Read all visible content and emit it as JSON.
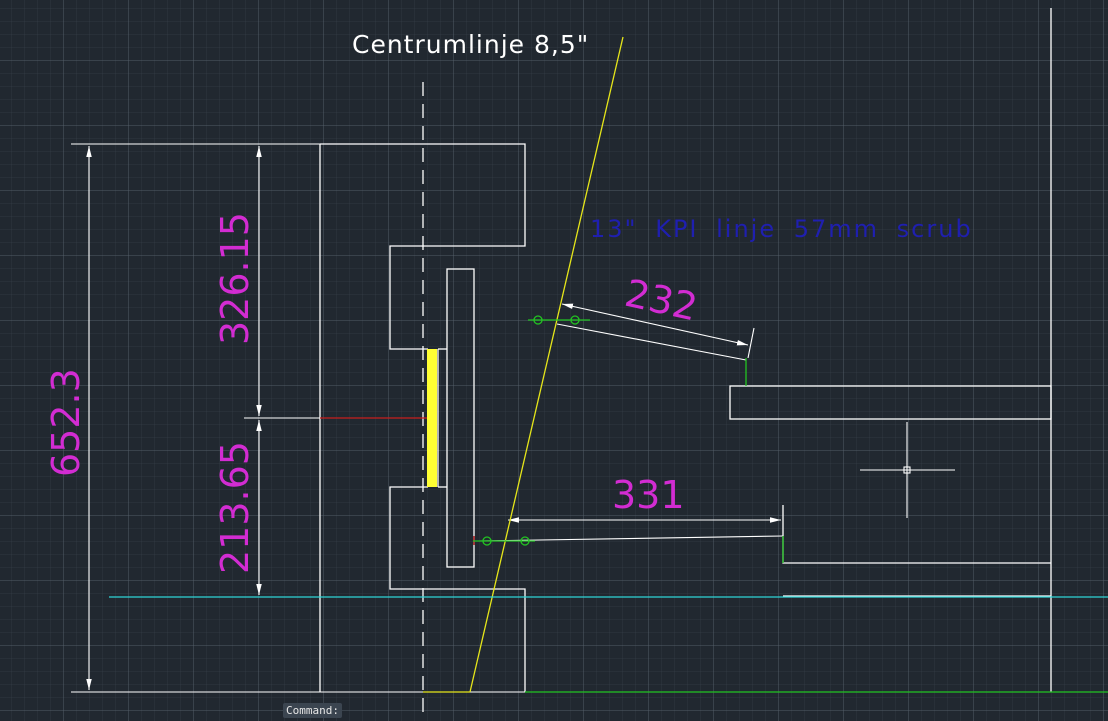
{
  "drawing": {
    "title_label": "Centrumlinje  8,5\"",
    "kpi_label": "13\" KPI linje 57mm scrub",
    "dimensions": {
      "overall": "652.3",
      "upper": "326.15",
      "lower": "213.65",
      "angled": "232",
      "horizontal": "331"
    },
    "colors": {
      "background": "#212830",
      "geometry": "#ffffff",
      "dimension_text": "#d22cd2",
      "kpi_text": "#1f1fb0",
      "yellow_line": "#ffff33",
      "cyan_line": "#2fd5d5",
      "green_line": "#22c422",
      "red_line": "#c81e1e"
    }
  },
  "command_line": {
    "prompt": "Command:"
  },
  "cursor": {
    "icon": "crosshair-cursor-icon"
  }
}
